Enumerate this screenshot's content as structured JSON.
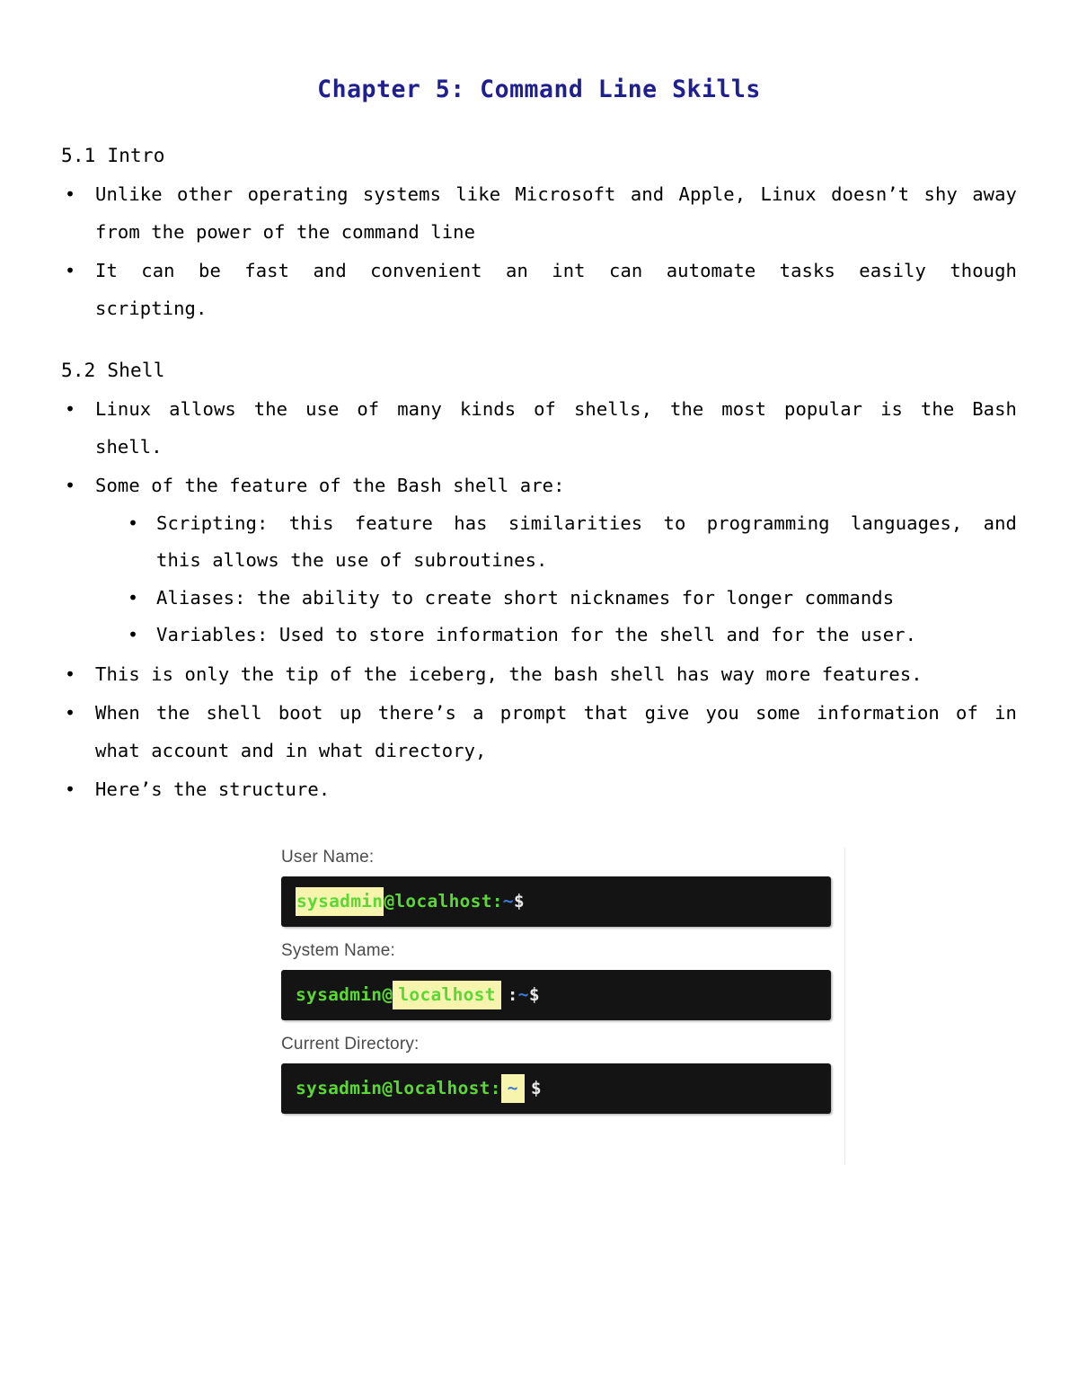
{
  "document": {
    "title": "Chapter 5: Command Line Skills",
    "title_color": "#1f1f8f"
  },
  "sections": [
    {
      "heading": "5.1 Intro",
      "bullets": [
        {
          "line1": "Unlike other operating systems like Microsoft and Apple, Linux doesn’t shy away",
          "line2": "from the power of the command line"
        },
        {
          "line1": "It can be fast and convenient an int can automate tasks easily though",
          "line2": "scripting."
        }
      ]
    },
    {
      "heading": "5.2 Shell",
      "bullets": [
        {
          "line1": "Linux allows the use of many kinds of shells, the most popular is the Bash",
          "line2": "shell."
        },
        {
          "line1": "Some of the feature of the Bash shell are:",
          "line2": ""
        }
      ],
      "subbullets": [
        {
          "line1": "Scripting: this feature has similarities to programming languages, and",
          "line2": "this allows the use of subroutines."
        },
        {
          "line1": "Aliases: the ability to create short nicknames for longer commands",
          "line2": ""
        },
        {
          "line1": "Variables: Used to store information for the shell and for the user.",
          "line2": ""
        }
      ],
      "bullets_after": [
        {
          "line1": "This is only the tip of the iceberg, the bash shell has way more features.",
          "line2": ""
        },
        {
          "line1": "When the shell boot up there’s a prompt that give you some information of in",
          "line2": "what account and in what directory,"
        },
        {
          "line1": "Here’s the structure.",
          "line2": ""
        }
      ]
    }
  ],
  "figure": {
    "panels": [
      {
        "label": "User Name:",
        "prompt_full": "sysadmin@localhost:~$",
        "highlight": "sysadmin",
        "tokens": {
          "highlighted": "sysadmin",
          "at_host": "@localhost",
          "colon": ":",
          "tilde": "~",
          "dollar": "$"
        }
      },
      {
        "label": "System Name:",
        "prompt_full": "sysadmin@localhost:~$",
        "highlight": "localhost",
        "tokens": {
          "user_at": "sysadmin@",
          "highlighted": "localhost",
          "colon": ":",
          "tilde": "~",
          "dollar": "$"
        }
      },
      {
        "label": "Current Directory:",
        "prompt_full": "sysadmin@localhost:~$",
        "highlight": "~",
        "tokens": {
          "user_at_host_colon": "sysadmin@localhost:",
          "highlighted": "~",
          "dollar": "$"
        }
      }
    ],
    "colors": {
      "terminal_background": "#141414",
      "prompt_green": "#5ad836",
      "tilde_blue": "#3a7bd5",
      "dollar_white": "#e9e9e9",
      "highlight_yellow": "#f7f4ad",
      "label_gray": "#4b4b4b"
    }
  }
}
